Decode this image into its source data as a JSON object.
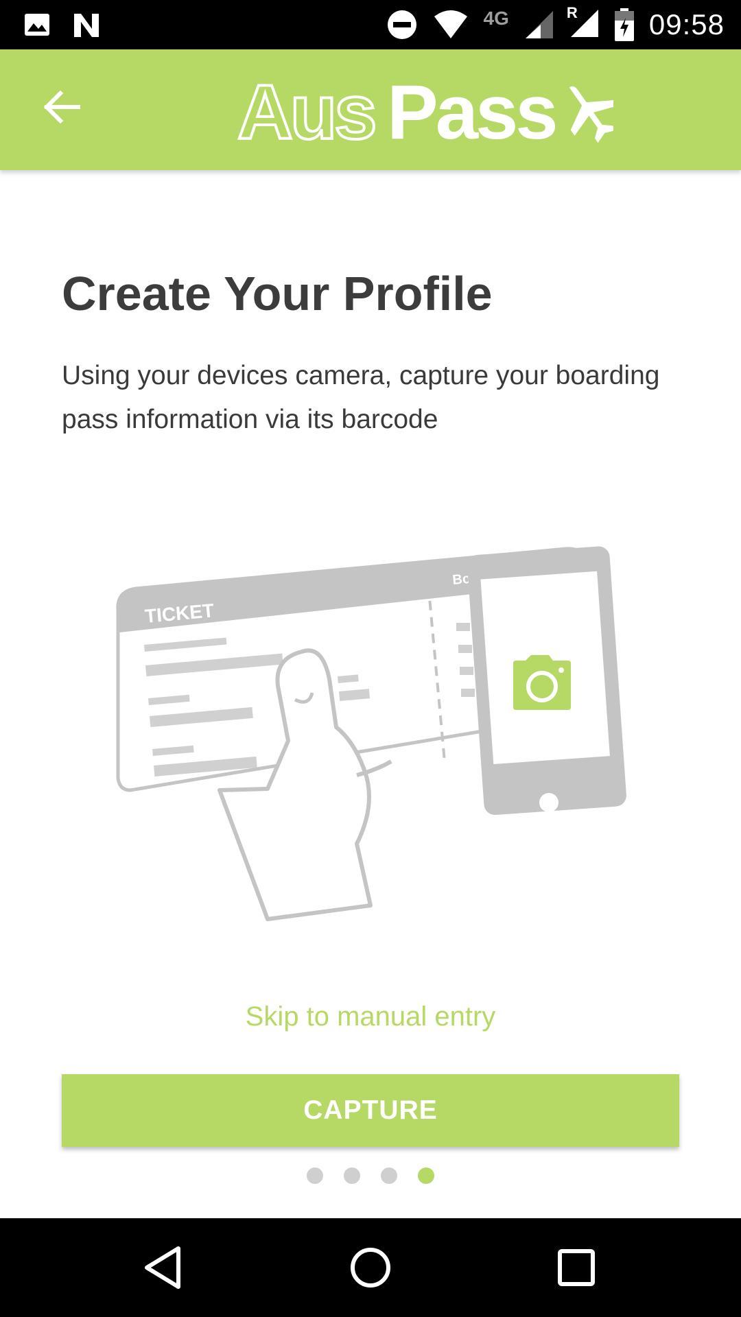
{
  "status_bar": {
    "network": "4G",
    "roaming": "R",
    "time": "09:58",
    "icons": [
      "image-icon",
      "n-notification-icon",
      "do-not-disturb-icon",
      "wifi-icon",
      "signal-icon",
      "signal-roaming-icon",
      "battery-charging-icon"
    ]
  },
  "app_bar": {
    "back_icon": "arrow-back-icon",
    "logo_part1": "Aus",
    "logo_part2": "Pass",
    "logo_icon": "airplane-icon"
  },
  "main": {
    "title": "Create Your Profile",
    "description": "Using your devices camera, capture your boarding pass information via its barcode",
    "illustration": {
      "ticket_label": "TICKET",
      "stub_label": "Bo"
    },
    "skip_link": "Skip to manual entry",
    "capture_button": "CAPTURE",
    "pager": {
      "total": 4,
      "active": 4
    }
  },
  "colors": {
    "accent": "#b5d964",
    "illustration_gray": "#c4c4c4",
    "text_dark": "#3c3c3c"
  },
  "nav_bar": {
    "icons": [
      "back-triangle-icon",
      "home-circle-icon",
      "recents-square-icon"
    ]
  }
}
